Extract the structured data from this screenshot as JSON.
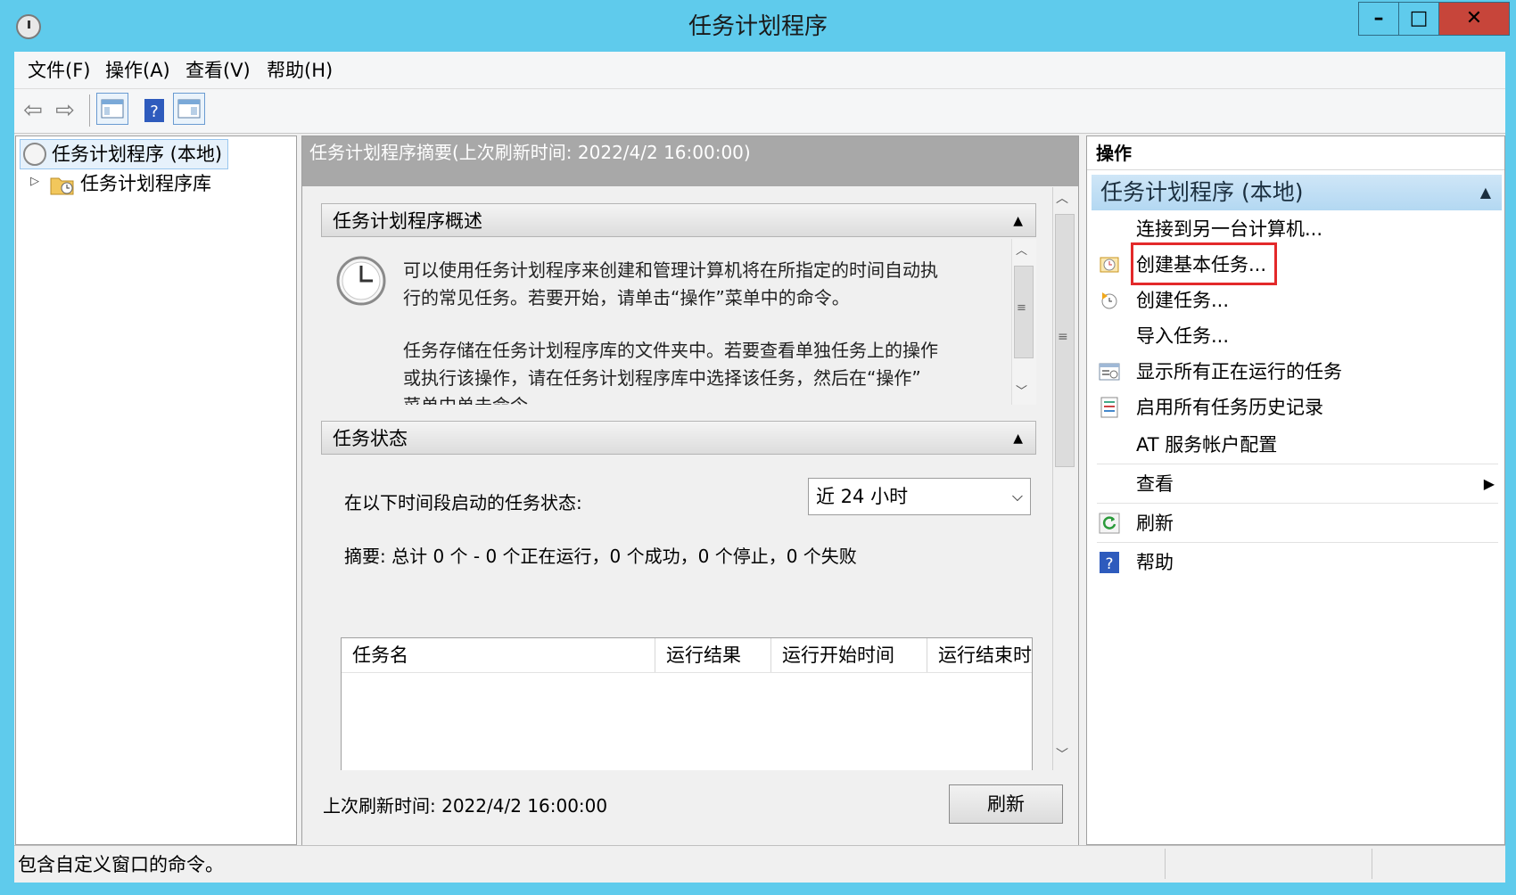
{
  "window": {
    "title": "任务计划程序"
  },
  "menu": [
    "文件(F)",
    "操作(A)",
    "查看(V)",
    "帮助(H)"
  ],
  "tree": {
    "root": "任务计划程序 (本地)",
    "library": "任务计划程序库"
  },
  "summary": {
    "header": "任务计划程序摘要(上次刷新时间: 2022/4/2 16:00:00)",
    "overview_title": "任务计划程序概述",
    "overview_lines": [
      "可以使用任务计划程序来创建和管理计算机将在所指定的时间自动执",
      "行的常见任务。若要开始，请单击“操作”菜单中的命令。",
      "任务存储在任务计划程序库的文件夹中。若要查看单独任务上的操作",
      "或执行该操作，请在任务计划程序库中选择该任务，然后在“操作”",
      "菜单中单击命令。"
    ],
    "status_title": "任务状态",
    "status_label": "在以下时间段启动的任务状态:",
    "period": "近 24 小时",
    "summary_line": "摘要: 总计 0 个 - 0 个正在运行，0 个成功，0 个停止，0 个失败",
    "columns": [
      "任务名",
      "运行结果",
      "运行开始时间",
      "运行结束时"
    ],
    "last_refresh": "上次刷新时间: 2022/4/2 16:00:00",
    "refresh_button": "刷新"
  },
  "actions": {
    "title": "操作",
    "group": "任务计划程序 (本地)",
    "items": [
      "连接到另一台计算机...",
      "创建基本任务...",
      "创建任务...",
      "导入任务...",
      "显示所有正在运行的任务",
      "启用所有任务历史记录",
      "AT 服务帐户配置",
      "查看",
      "刷新",
      "帮助"
    ]
  },
  "status_bar": {
    "text": "包含自定义窗口的命令。"
  },
  "colors": {
    "titlebar": "#5fcbec",
    "highlight": "#e3292a",
    "close": "#c7453a"
  }
}
